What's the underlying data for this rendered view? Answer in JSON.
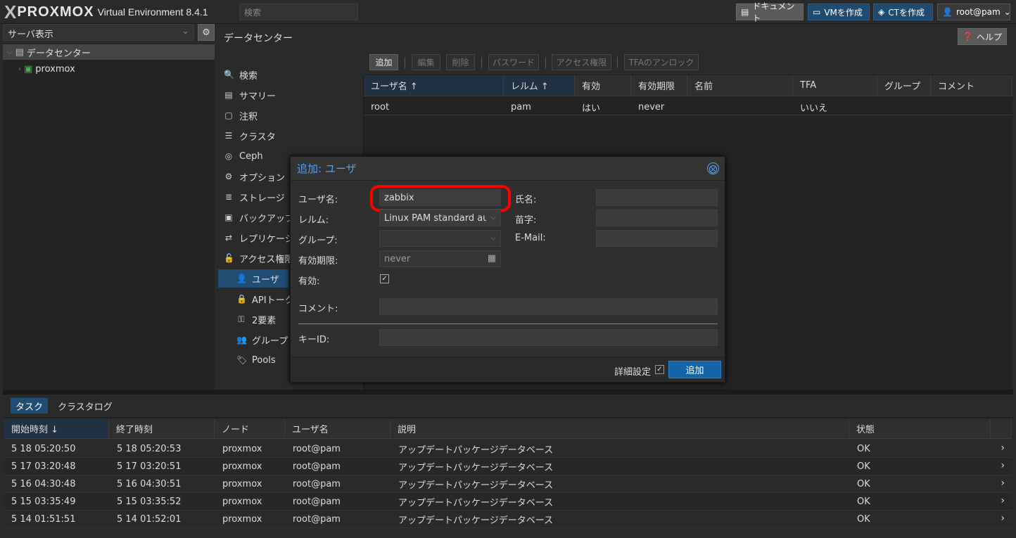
{
  "app": {
    "logo_x": "X",
    "logo_text": "PROXMOX",
    "version": "Virtual Environment 8.4.1",
    "search_placeholder": "検索"
  },
  "topbar": {
    "docs": "ドキュメント",
    "create_vm": "VMを作成",
    "create_ct": "CTを作成",
    "user": "root@pam"
  },
  "sidebar": {
    "view_select": "サーバ表示",
    "tree": {
      "datacenter": "データセンター",
      "node": "proxmox"
    }
  },
  "header": {
    "title": "データセンター",
    "help": "ヘルプ"
  },
  "nav": [
    {
      "label": "検索",
      "icon": "search-icon"
    },
    {
      "label": "サマリー",
      "icon": "book-icon"
    },
    {
      "label": "注釈",
      "icon": "note-icon"
    },
    {
      "label": "クラスタ",
      "icon": "server-icon"
    },
    {
      "label": "Ceph",
      "icon": "ceph-icon"
    },
    {
      "label": "オプション",
      "icon": "gear-icon"
    },
    {
      "label": "ストレージ",
      "icon": "database-icon"
    },
    {
      "label": "バックアップ",
      "icon": "floppy-icon"
    },
    {
      "label": "レプリケーション",
      "icon": "retweet-icon"
    },
    {
      "label": "アクセス権限",
      "icon": "unlock-icon"
    }
  ],
  "nav_sub": [
    {
      "label": "ユーザ",
      "icon": "user-icon"
    },
    {
      "label": "APIトークン",
      "icon": "lock-icon"
    },
    {
      "label": "2要素",
      "icon": "key-icon"
    },
    {
      "label": "グループ",
      "icon": "users-icon"
    },
    {
      "label": "Pools",
      "icon": "tags-icon"
    }
  ],
  "toolbar": {
    "add": "追加",
    "edit": "編集",
    "delete": "削除",
    "password": "パスワード",
    "permissions": "アクセス権限",
    "tfa_unlock": "TFAのアンロック"
  },
  "user_grid": {
    "columns": [
      "ユーザ名 ↑",
      "レルム ↑",
      "有効",
      "有効期限",
      "名前",
      "TFA",
      "グループ",
      "コメント"
    ],
    "rows": [
      [
        "root",
        "pam",
        "はい",
        "never",
        "",
        "いいえ",
        "",
        ""
      ]
    ]
  },
  "dialog": {
    "title": "追加: ユーザ",
    "close_glyph": "⨂",
    "labels": {
      "username": "ユーザ名:",
      "realm": "レルム:",
      "group": "グループ:",
      "expire": "有効期限:",
      "enabled": "有効:",
      "firstname": "氏名:",
      "lastname": "苗字:",
      "email": "E-Mail:",
      "comment": "コメント:",
      "keyid": "キーID:"
    },
    "values": {
      "username": "zabbix",
      "realm": "Linux PAM standard authentication",
      "group": "",
      "expire": "never",
      "enabled": true,
      "firstname": "",
      "lastname": "",
      "email": "",
      "comment": "",
      "keyid": ""
    },
    "advanced": "詳細設定",
    "add_button": "追加",
    "highlight_color": "#ff0000"
  },
  "bottom": {
    "tabs": [
      "タスク",
      "クラスタログ"
    ],
    "columns": [
      "開始時刻 ↓",
      "終了時刻",
      "ノード",
      "ユーザ名",
      "説明",
      "状態"
    ],
    "rows": [
      [
        "5 18 05:20:50",
        "5 18 05:20:53",
        "proxmox",
        "root@pam",
        "アップデートパッケージデータベース",
        "OK"
      ],
      [
        "5 17 03:20:48",
        "5 17 03:20:51",
        "proxmox",
        "root@pam",
        "アップデートパッケージデータベース",
        "OK"
      ],
      [
        "5 16 04:30:48",
        "5 16 04:30:51",
        "proxmox",
        "root@pam",
        "アップデートパッケージデータベース",
        "OK"
      ],
      [
        "5 15 03:35:49",
        "5 15 03:35:52",
        "proxmox",
        "root@pam",
        "アップデートパッケージデータベース",
        "OK"
      ],
      [
        "5 14 01:51:51",
        "5 14 01:52:01",
        "proxmox",
        "root@pam",
        "アップデートパッケージデータベース",
        "OK"
      ]
    ]
  },
  "colors": {
    "accent": "#1564a8",
    "selected": "#1f4d73",
    "dialog_title": "#4aa3ff"
  }
}
